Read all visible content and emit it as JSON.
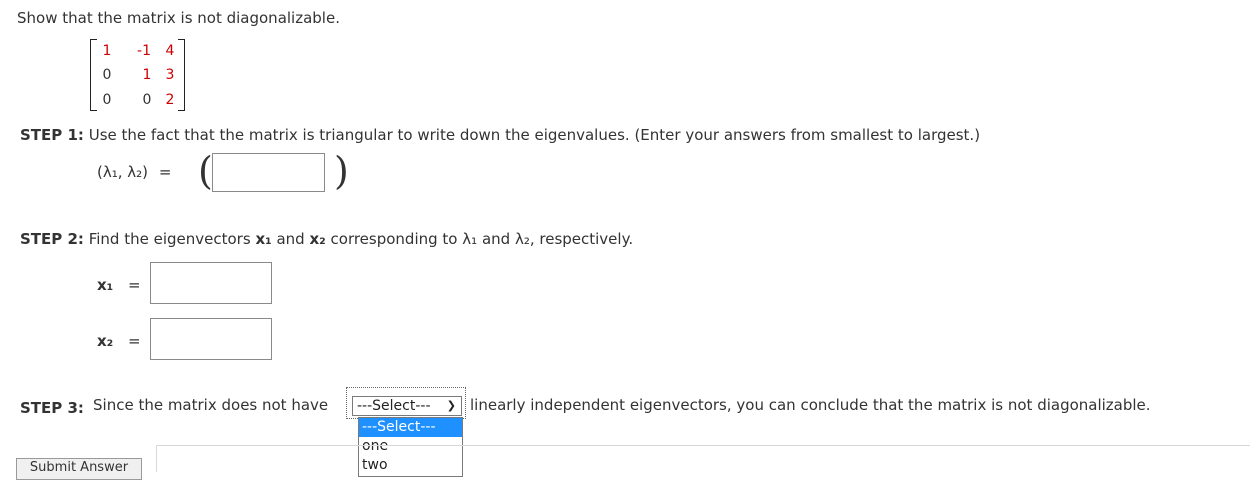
{
  "question": "Show that the matrix is not diagonalizable.",
  "matrix": {
    "rows": [
      [
        "1",
        "-1",
        "4"
      ],
      [
        "0",
        "1",
        "3"
      ],
      [
        "0",
        "0",
        "2"
      ]
    ]
  },
  "step1": {
    "label": "STEP 1:",
    "text": "Use the fact that the matrix is triangular to write down the eigenvalues. (Enter your answers from smallest to largest.)",
    "lhs": "(λ₁, λ₂)",
    "equals": "="
  },
  "step2": {
    "label": "STEP 2:",
    "text_a": "Find the eigenvectors",
    "x1": "x₁",
    "and": "and",
    "x2": "x₂",
    "text_b": "corresponding to",
    "l1": "λ₁",
    "and2": "and",
    "l2": "λ₂, respectively.",
    "x1_label": "x₁",
    "x2_label": "x₂",
    "equals": "="
  },
  "step3": {
    "label": "STEP 3:",
    "text_a": "Since the matrix does not have",
    "select_value": "---Select---",
    "options": [
      "---Select---",
      "one",
      "two"
    ],
    "text_b": "linearly independent eigenvectors, you can conclude that the matrix is not diagonalizable."
  },
  "submit_label": "Submit Answer"
}
